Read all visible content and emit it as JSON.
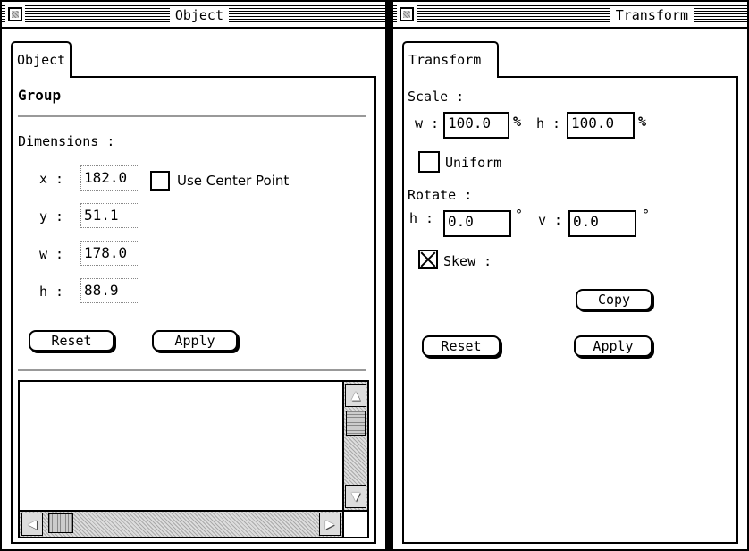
{
  "object_window": {
    "title": "Object",
    "tab_label": "Object",
    "heading": "Group",
    "dimensions_label": "Dimensions :",
    "fields": {
      "x_label": "x :",
      "x_value": "182.0",
      "y_label": "y :",
      "y_value": "51.1",
      "w_label": "w :",
      "w_value": "178.0",
      "h_label": "h :",
      "h_value": "88.9"
    },
    "use_center_point_label": "Use Center Point",
    "use_center_point_checked": false,
    "reset_label": "Reset",
    "apply_label": "Apply"
  },
  "transform_window": {
    "title": "Transform",
    "tab_label": "Transform",
    "scale_label": "Scale :",
    "scale_w_label": "w :",
    "scale_w_value": "100.0",
    "scale_h_label": "h :",
    "scale_h_value": "100.0",
    "percent_symbol": "%",
    "uniform_label": "Uniform",
    "uniform_checked": false,
    "rotate_label": "Rotate :",
    "rotate_h_label": "h :",
    "rotate_h_value": "0.0",
    "rotate_v_label": "v :",
    "rotate_v_value": "0.0",
    "degree_symbol": "°",
    "skew_label": "Skew :",
    "skew_checked": true,
    "copy_label": "Copy",
    "reset_label": "Reset",
    "apply_label": "Apply"
  },
  "icons": {
    "scroll_up": "▲",
    "scroll_down": "▼",
    "scroll_left": "◀",
    "scroll_right": "▶"
  }
}
